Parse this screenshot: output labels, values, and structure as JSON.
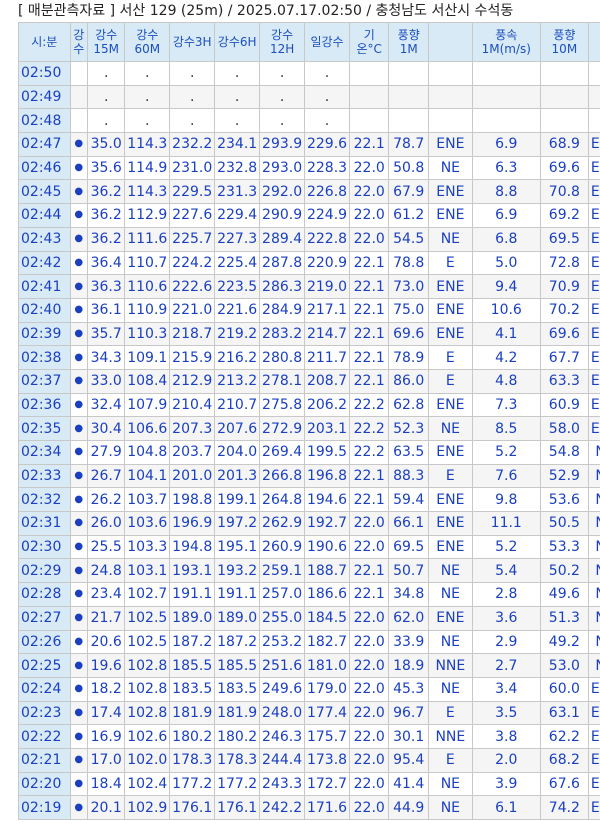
{
  "title": "[ 매분관측자료 ] 서산 129 (25m) / 2025.07.17.02:50 / 충청남도 서산시 수석동",
  "headers": [
    "시:분",
    "강\n수",
    "강수\n15M",
    "강수\n60M",
    "강수3H",
    "강수6H",
    "강수\n12H",
    "일강수",
    "기\n온°C",
    "풍향1M",
    "",
    "풍속\n1M(m/s)",
    "풍향10M",
    ""
  ],
  "rows": [
    [
      "02:50",
      "",
      ".",
      ".",
      ".",
      ".",
      ".",
      ".",
      "",
      "",
      "",
      "",
      "",
      ""
    ],
    [
      "02:49",
      "",
      ".",
      ".",
      ".",
      ".",
      ".",
      ".",
      "",
      "",
      "",
      "",
      "",
      ""
    ],
    [
      "02:48",
      "",
      ".",
      ".",
      ".",
      ".",
      ".",
      ".",
      "",
      "",
      "",
      "",
      "",
      ""
    ],
    [
      "02:47",
      "●",
      "35.0",
      "114.3",
      "232.2",
      "234.1",
      "293.9",
      "229.6",
      "22.1",
      "78.7",
      "ENE",
      "6.9",
      "68.9",
      "ENE"
    ],
    [
      "02:46",
      "●",
      "35.6",
      "114.9",
      "231.0",
      "232.8",
      "293.0",
      "228.3",
      "22.0",
      "50.8",
      "NE",
      "6.3",
      "69.6",
      "ENE"
    ],
    [
      "02:45",
      "●",
      "36.2",
      "114.3",
      "229.5",
      "231.3",
      "292.0",
      "226.8",
      "22.0",
      "67.9",
      "ENE",
      "8.8",
      "70.8",
      "ENE"
    ],
    [
      "02:44",
      "●",
      "36.2",
      "112.9",
      "227.6",
      "229.4",
      "290.9",
      "224.9",
      "22.0",
      "61.2",
      "ENE",
      "6.9",
      "69.2",
      "ENE"
    ],
    [
      "02:43",
      "●",
      "36.2",
      "111.6",
      "225.7",
      "227.3",
      "289.4",
      "222.8",
      "22.0",
      "54.5",
      "NE",
      "6.8",
      "69.5",
      "ENE"
    ],
    [
      "02:42",
      "●",
      "36.4",
      "110.7",
      "224.2",
      "225.4",
      "287.8",
      "220.9",
      "22.1",
      "78.8",
      "E",
      "5.0",
      "72.8",
      "ENE"
    ],
    [
      "02:41",
      "●",
      "36.3",
      "110.6",
      "222.6",
      "223.5",
      "286.3",
      "219.0",
      "22.1",
      "73.0",
      "ENE",
      "9.4",
      "70.9",
      "ENE"
    ],
    [
      "02:40",
      "●",
      "36.1",
      "110.9",
      "221.0",
      "221.6",
      "284.9",
      "217.1",
      "22.1",
      "75.0",
      "ENE",
      "10.6",
      "70.2",
      "ENE"
    ],
    [
      "02:39",
      "●",
      "35.7",
      "110.3",
      "218.7",
      "219.2",
      "283.2",
      "214.7",
      "22.1",
      "69.6",
      "ENE",
      "4.1",
      "69.6",
      "ENE"
    ],
    [
      "02:38",
      "●",
      "34.3",
      "109.1",
      "215.9",
      "216.2",
      "280.8",
      "211.7",
      "22.1",
      "78.9",
      "E",
      "4.2",
      "67.7",
      "ENE"
    ],
    [
      "02:37",
      "●",
      "33.0",
      "108.4",
      "212.9",
      "213.2",
      "278.1",
      "208.7",
      "22.1",
      "86.0",
      "E",
      "4.8",
      "63.3",
      "ENE"
    ],
    [
      "02:36",
      "●",
      "32.4",
      "107.9",
      "210.4",
      "210.7",
      "275.8",
      "206.2",
      "22.2",
      "62.8",
      "ENE",
      "7.3",
      "60.9",
      "ENE"
    ],
    [
      "02:35",
      "●",
      "30.4",
      "106.6",
      "207.3",
      "207.6",
      "272.9",
      "203.1",
      "22.2",
      "52.3",
      "NE",
      "8.5",
      "58.0",
      "ENE"
    ],
    [
      "02:34",
      "●",
      "27.9",
      "104.8",
      "203.7",
      "204.0",
      "269.4",
      "199.5",
      "22.2",
      "63.5",
      "ENE",
      "5.2",
      "54.8",
      "NE"
    ],
    [
      "02:33",
      "●",
      "26.7",
      "104.1",
      "201.0",
      "201.3",
      "266.8",
      "196.8",
      "22.1",
      "88.3",
      "E",
      "7.6",
      "52.9",
      "NE"
    ],
    [
      "02:32",
      "●",
      "26.2",
      "103.7",
      "198.8",
      "199.1",
      "264.8",
      "194.6",
      "22.1",
      "59.4",
      "ENE",
      "9.8",
      "53.6",
      "NE"
    ],
    [
      "02:31",
      "●",
      "26.0",
      "103.6",
      "196.9",
      "197.2",
      "262.9",
      "192.7",
      "22.0",
      "66.1",
      "ENE",
      "11.1",
      "50.5",
      "NE"
    ],
    [
      "02:30",
      "●",
      "25.5",
      "103.3",
      "194.8",
      "195.1",
      "260.9",
      "190.6",
      "22.0",
      "69.5",
      "ENE",
      "5.2",
      "53.3",
      "NE"
    ],
    [
      "02:29",
      "●",
      "24.8",
      "103.1",
      "193.1",
      "193.2",
      "259.1",
      "188.7",
      "22.1",
      "50.7",
      "NE",
      "5.4",
      "50.2",
      "NE"
    ],
    [
      "02:28",
      "●",
      "23.4",
      "102.7",
      "191.1",
      "191.1",
      "257.0",
      "186.6",
      "22.1",
      "34.8",
      "NE",
      "2.8",
      "49.6",
      "NE"
    ],
    [
      "02:27",
      "●",
      "21.7",
      "102.5",
      "189.0",
      "189.0",
      "255.0",
      "184.5",
      "22.0",
      "62.0",
      "ENE",
      "3.6",
      "51.3",
      "NE"
    ],
    [
      "02:26",
      "●",
      "20.6",
      "102.5",
      "187.2",
      "187.2",
      "253.2",
      "182.7",
      "22.0",
      "33.9",
      "NE",
      "2.9",
      "49.2",
      "NE"
    ],
    [
      "02:25",
      "●",
      "19.6",
      "102.8",
      "185.5",
      "185.5",
      "251.6",
      "181.0",
      "22.0",
      "18.9",
      "NNE",
      "2.7",
      "53.0",
      "NE"
    ],
    [
      "02:24",
      "●",
      "18.2",
      "102.8",
      "183.5",
      "183.5",
      "249.6",
      "179.0",
      "22.0",
      "45.3",
      "NE",
      "3.4",
      "60.0",
      "ENE"
    ],
    [
      "02:23",
      "●",
      "17.4",
      "102.8",
      "181.9",
      "181.9",
      "248.0",
      "177.4",
      "22.0",
      "96.7",
      "E",
      "3.5",
      "63.1",
      "ENE"
    ],
    [
      "02:22",
      "●",
      "16.9",
      "102.6",
      "180.2",
      "180.2",
      "246.3",
      "175.7",
      "22.0",
      "30.1",
      "NNE",
      "3.8",
      "62.2",
      "ENE"
    ],
    [
      "02:21",
      "●",
      "17.0",
      "102.0",
      "178.3",
      "178.3",
      "244.4",
      "173.8",
      "22.0",
      "95.4",
      "E",
      "2.0",
      "68.2",
      "ENE"
    ],
    [
      "02:20",
      "●",
      "18.4",
      "102.4",
      "177.2",
      "177.2",
      "243.3",
      "172.7",
      "22.0",
      "41.4",
      "NE",
      "3.9",
      "67.6",
      "ENE"
    ],
    [
      "02:19",
      "●",
      "20.1",
      "102.9",
      "176.1",
      "176.1",
      "242.2",
      "171.6",
      "22.0",
      "44.9",
      "NE",
      "6.1",
      "74.2",
      "ENE"
    ]
  ]
}
